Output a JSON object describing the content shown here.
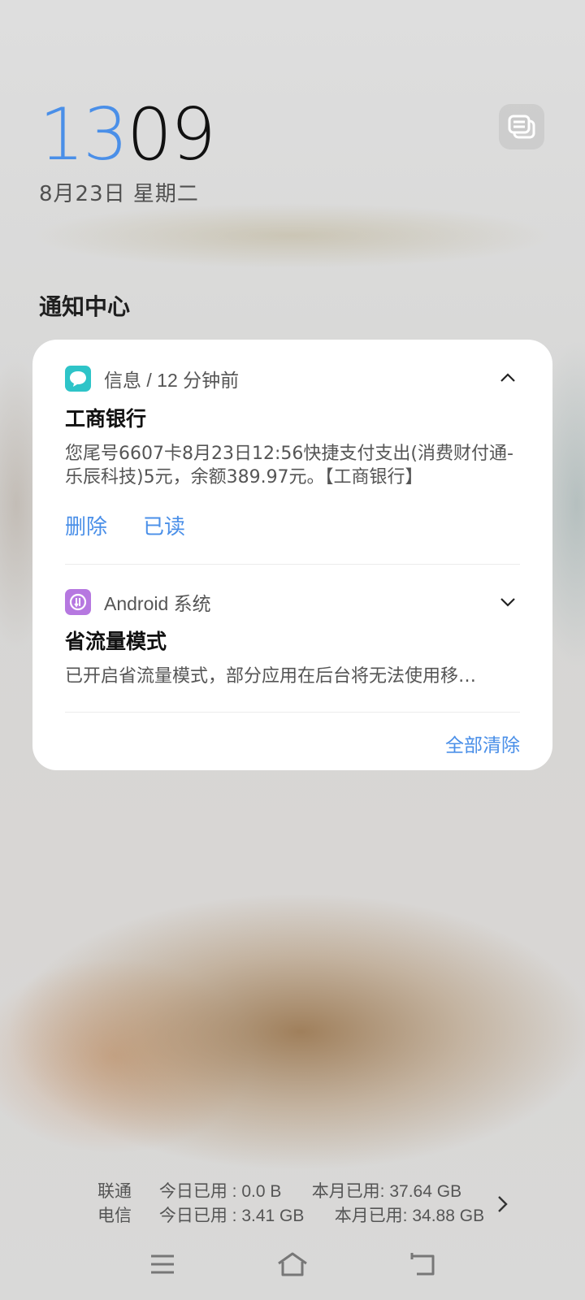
{
  "clock": {
    "hours": "13",
    "minutes": "09"
  },
  "date": "8月23日 星期二",
  "notification_center": {
    "title": "通知中心",
    "notifications": [
      {
        "app_meta": "信息 / 12 分钟前",
        "icon": "message-bubble-icon",
        "title": "工商银行",
        "body": "您尾号6607卡8月23日12:56快捷支付支出(消费财付通-乐辰科技)5元，余额389.97元。【工商银行】",
        "expanded": true,
        "actions": [
          "删除",
          "已读"
        ]
      },
      {
        "app_meta": "Android 系统",
        "icon": "data-saver-icon",
        "title": "省流量模式",
        "body": "已开启省流量模式，部分应用在后台将无法使用移…",
        "expanded": false
      }
    ],
    "clear_all": "全部清除"
  },
  "data_usage": [
    {
      "carrier": "联通",
      "today": "今日已用 : 0.0 B",
      "month": "本月已用: 37.64 GB"
    },
    {
      "carrier": "电信",
      "today": "今日已用 : 3.41 GB",
      "month": "本月已用: 34.88 GB"
    }
  ],
  "colors": {
    "accent": "#4a8fe8",
    "messages_icon": "#2ec4c8",
    "android_icon": "#b678e0"
  }
}
